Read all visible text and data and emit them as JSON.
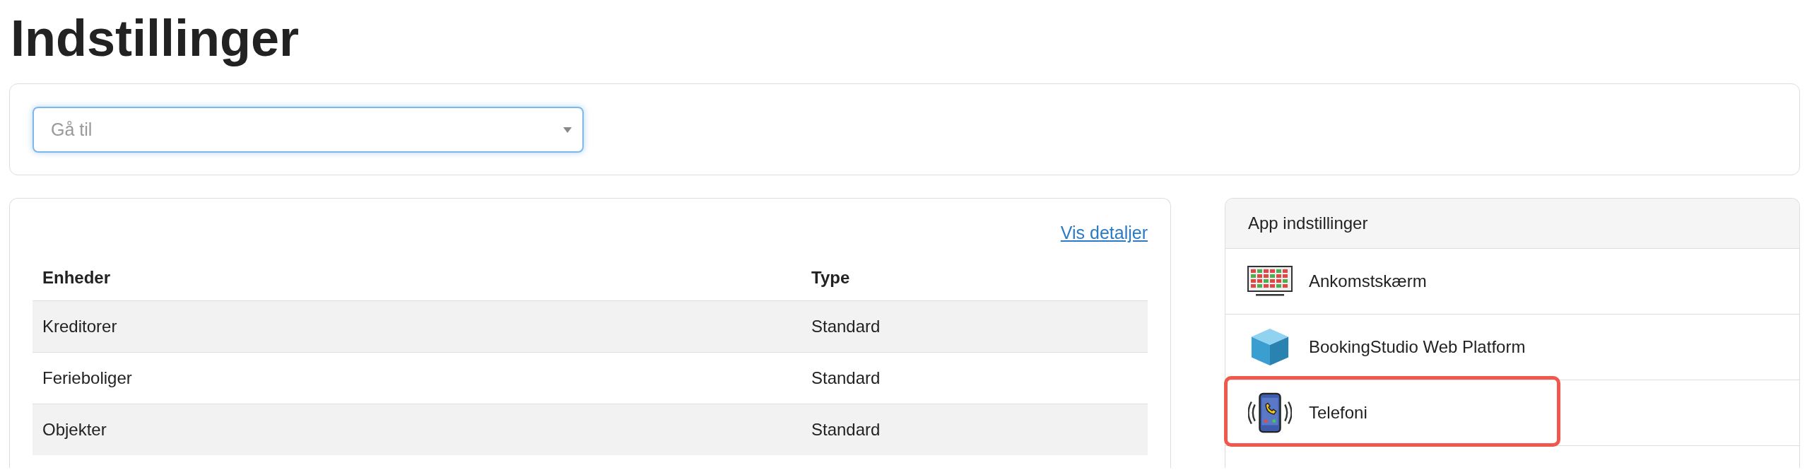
{
  "title": "Indstillinger",
  "goto": {
    "placeholder": "Gå til"
  },
  "entities": {
    "link": "Vis detaljer",
    "columns": [
      "Enheder",
      "Type"
    ],
    "rows": [
      {
        "cells": [
          "Kreditorer",
          "Standard"
        ]
      },
      {
        "cells": [
          "Ferieboliger",
          "Standard"
        ]
      },
      {
        "cells": [
          "Objekter",
          "Standard"
        ]
      }
    ]
  },
  "app_settings": {
    "title": "App indstillinger",
    "items": [
      {
        "label": "Ankomstskærm",
        "kind": "screen",
        "highlighted": false
      },
      {
        "label": "BookingStudio Web Platform",
        "kind": "cube",
        "highlighted": false
      },
      {
        "label": "Telefoni",
        "kind": "phone",
        "highlighted": true
      }
    ]
  }
}
